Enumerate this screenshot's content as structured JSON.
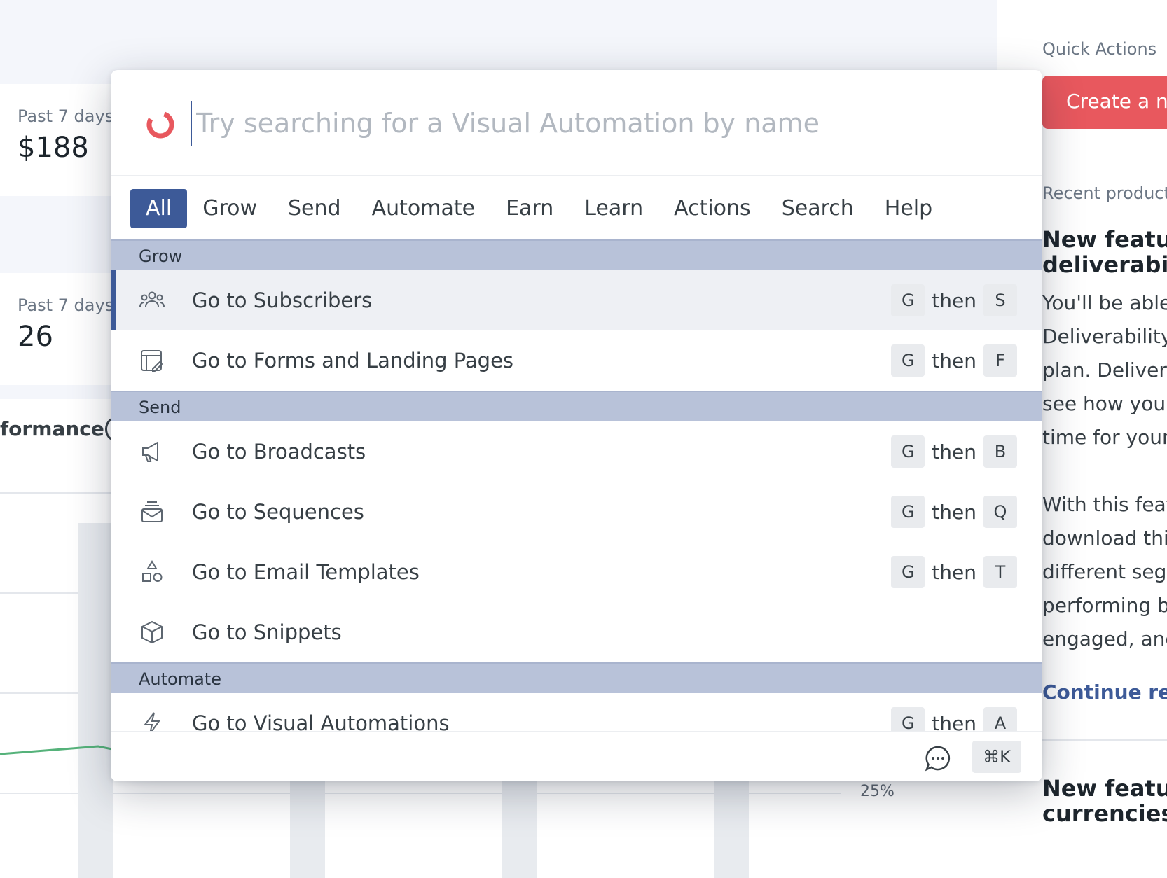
{
  "background": {
    "stat_cards": [
      {
        "label": "Past 7 days",
        "value": "$188"
      },
      {
        "label": "Past 7 days",
        "value": "26"
      }
    ],
    "performance_heading": "formance",
    "axis_tick": "25%"
  },
  "right_panel": {
    "quick_actions_title": "Quick Actions",
    "create_button": "Create a ne",
    "recent_title": "Recent product",
    "news1_heading_line1": "New feature",
    "news1_heading_line2": "deliverabilit",
    "news1_body": [
      "You'll be able",
      "Deliverability",
      "plan. Delivera",
      "see how your",
      "time for your",
      "",
      "With this featu",
      "download this",
      "different segm",
      "performing be",
      "engaged, and"
    ],
    "continue_link": "Continue rea",
    "news2_heading_line1": "New feature",
    "news2_heading_line2": "currencies"
  },
  "palette": {
    "search": {
      "placeholder": "Try searching for a Visual Automation by name",
      "value": ""
    },
    "tabs": [
      {
        "label": "All",
        "active": true
      },
      {
        "label": "Grow"
      },
      {
        "label": "Send"
      },
      {
        "label": "Automate"
      },
      {
        "label": "Earn"
      },
      {
        "label": "Learn"
      },
      {
        "label": "Actions"
      },
      {
        "label": "Search"
      },
      {
        "label": "Help"
      }
    ],
    "sections": [
      {
        "title": "Grow",
        "items": [
          {
            "label": "Go to Subscribers",
            "icon": "subscribers-icon",
            "keys": [
              "G",
              "S"
            ],
            "selected": true
          },
          {
            "label": "Go to Forms and Landing Pages",
            "icon": "forms-icon",
            "keys": [
              "G",
              "F"
            ]
          }
        ]
      },
      {
        "title": "Send",
        "items": [
          {
            "label": "Go to Broadcasts",
            "icon": "megaphone-icon",
            "keys": [
              "G",
              "B"
            ]
          },
          {
            "label": "Go to Sequences",
            "icon": "sequences-icon",
            "keys": [
              "G",
              "Q"
            ]
          },
          {
            "label": "Go to Email Templates",
            "icon": "templates-icon",
            "keys": [
              "G",
              "T"
            ]
          },
          {
            "label": "Go to Snippets",
            "icon": "cube-icon",
            "keys": []
          }
        ]
      },
      {
        "title": "Automate",
        "items": [
          {
            "label": "Go to Visual Automations",
            "icon": "lightning-icon",
            "keys": [
              "G",
              "A"
            ]
          }
        ]
      }
    ],
    "then_word": "then",
    "footer": {
      "shortcut": "⌘K",
      "chat_icon": "chat-icon"
    },
    "colors": {
      "accent": "#3d5a98",
      "section_bg": "#b8c2d9",
      "logo": "#e8585e"
    }
  }
}
